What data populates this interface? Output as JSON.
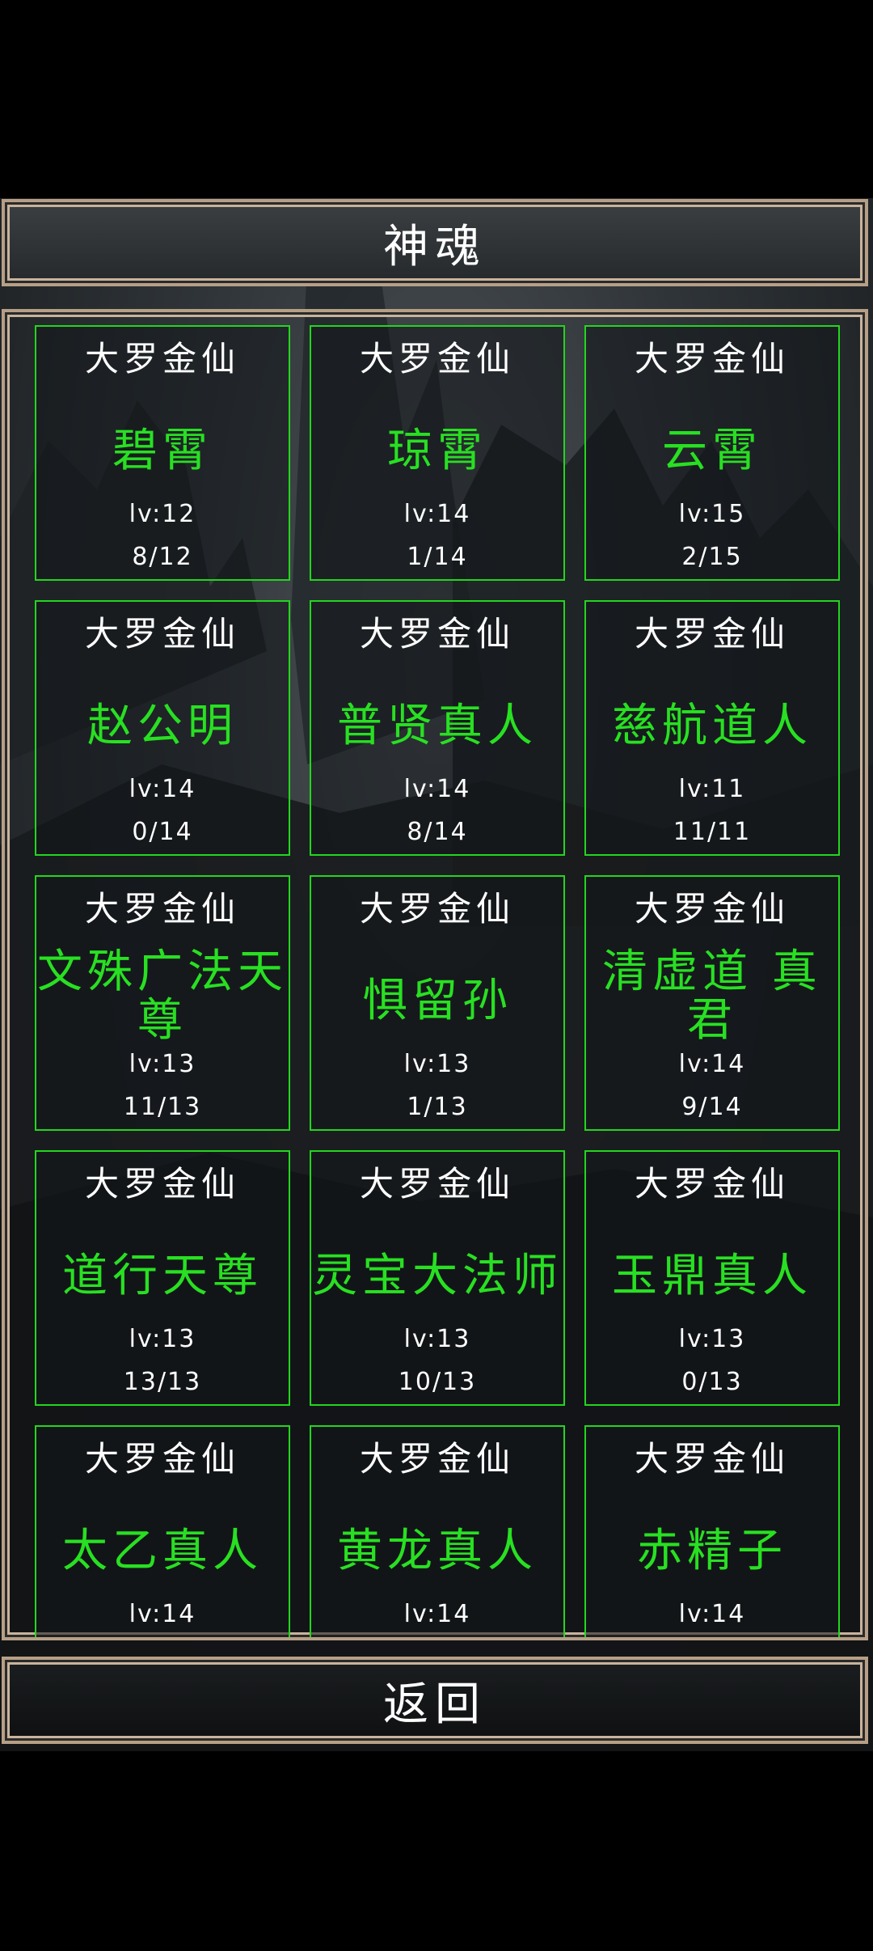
{
  "header": {
    "title": "神魂"
  },
  "footer": {
    "back_label": "返回"
  },
  "cards": [
    {
      "rank": "大罗金仙",
      "name": "碧霄",
      "level": "lv:12",
      "count": "8/12"
    },
    {
      "rank": "大罗金仙",
      "name": "琼霄",
      "level": "lv:14",
      "count": "1/14"
    },
    {
      "rank": "大罗金仙",
      "name": "云霄",
      "level": "lv:15",
      "count": "2/15"
    },
    {
      "rank": "大罗金仙",
      "name": "赵公明",
      "level": "lv:14",
      "count": "0/14"
    },
    {
      "rank": "大罗金仙",
      "name": "普贤真人",
      "level": "lv:14",
      "count": "8/14"
    },
    {
      "rank": "大罗金仙",
      "name": "慈航道人",
      "level": "lv:11",
      "count": "11/11"
    },
    {
      "rank": "大罗金仙",
      "name": "文殊广法天尊",
      "level": "lv:13",
      "count": "11/13"
    },
    {
      "rank": "大罗金仙",
      "name": "惧留孙",
      "level": "lv:13",
      "count": "1/13"
    },
    {
      "rank": "大罗金仙",
      "name": "清虚道 真君",
      "level": "lv:14",
      "count": "9/14"
    },
    {
      "rank": "大罗金仙",
      "name": "道行天尊",
      "level": "lv:13",
      "count": "13/13"
    },
    {
      "rank": "大罗金仙",
      "name": "灵宝大法师",
      "level": "lv:13",
      "count": "10/13"
    },
    {
      "rank": "大罗金仙",
      "name": "玉鼎真人",
      "level": "lv:13",
      "count": "0/13"
    },
    {
      "rank": "大罗金仙",
      "name": "太乙真人",
      "level": "lv:14",
      "count": ""
    },
    {
      "rank": "大罗金仙",
      "name": "黄龙真人",
      "level": "lv:14",
      "count": ""
    },
    {
      "rank": "大罗金仙",
      "name": "赤精子",
      "level": "lv:14",
      "count": ""
    }
  ],
  "colors": {
    "card_border": "#22d61e",
    "name_text": "#28e022",
    "frame_border": "#b69f86"
  }
}
